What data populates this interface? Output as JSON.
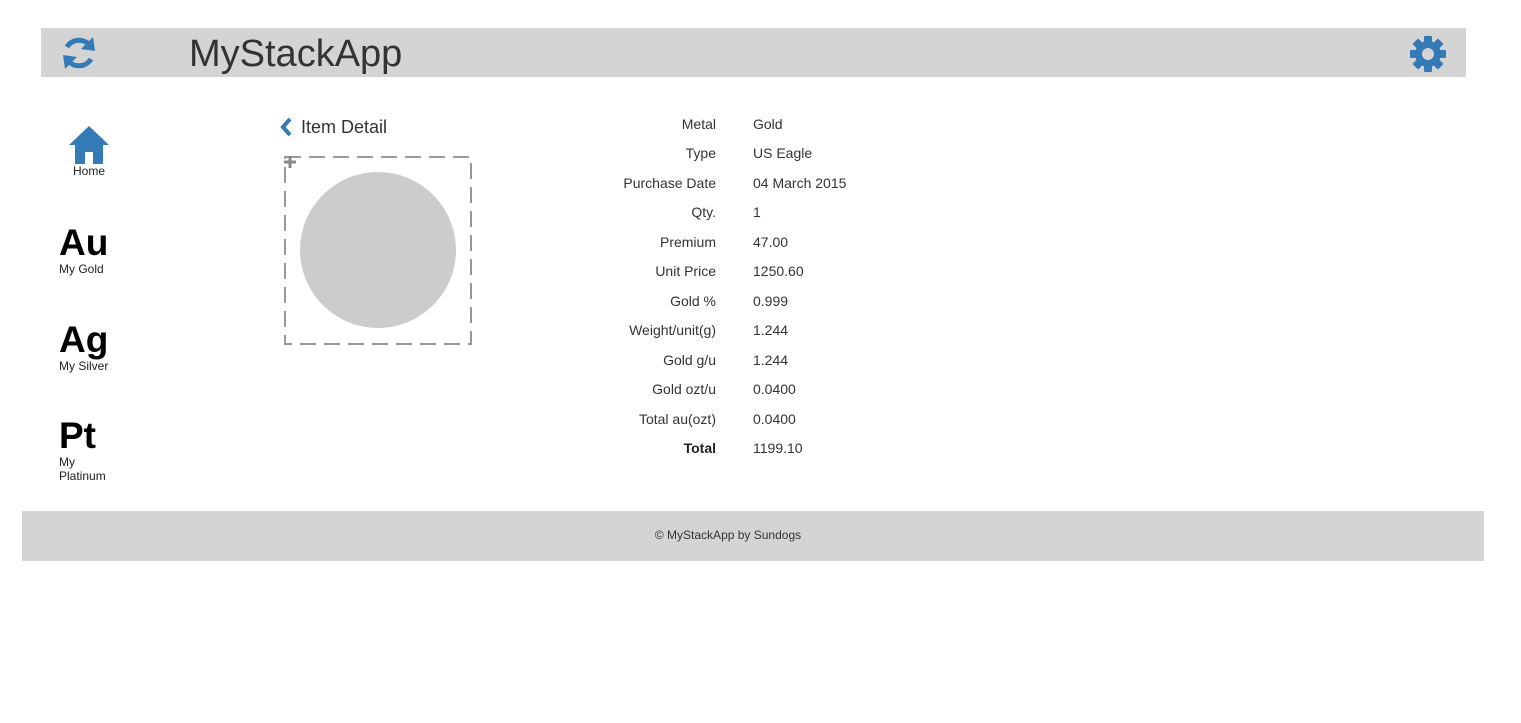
{
  "app": {
    "title": "MyStackApp"
  },
  "header": {
    "refresh_icon": "refresh-icon",
    "settings_icon": "gear-icon",
    "accent_color": "#337ab7"
  },
  "nav": {
    "home": {
      "label": "Home",
      "icon": "home-icon"
    },
    "items": [
      {
        "symbol": "Au",
        "label": "My Gold"
      },
      {
        "symbol": "Ag",
        "label": "My Silver"
      },
      {
        "symbol": "Pt",
        "label": "My Platinum"
      }
    ]
  },
  "detail": {
    "back_icon": "chevron-left-icon",
    "title": "Item Detail",
    "image_placeholder_color": "#cccccc",
    "add_icon": "plus-icon",
    "rows": [
      {
        "label": "Metal",
        "value": "Gold"
      },
      {
        "label": "Type",
        "value": "US Eagle"
      },
      {
        "label": "Purchase Date",
        "value": "04 March 2015"
      },
      {
        "label": "Qty.",
        "value": "1"
      },
      {
        "label": "Premium",
        "value": "47.00"
      },
      {
        "label": "Unit Price",
        "value": "1250.60"
      },
      {
        "label": "Gold %",
        "value": "0.999"
      },
      {
        "label": "Weight/unit(g)",
        "value": "1.244"
      },
      {
        "label": "Gold g/u",
        "value": "1.244"
      },
      {
        "label": "Gold ozt/u",
        "value": "0.0400"
      },
      {
        "label": "Total au(ozt)",
        "value": "0.0400"
      },
      {
        "label": "Total",
        "value": "1199.10"
      }
    ]
  },
  "footer": {
    "text": "© MyStackApp by Sundogs"
  }
}
